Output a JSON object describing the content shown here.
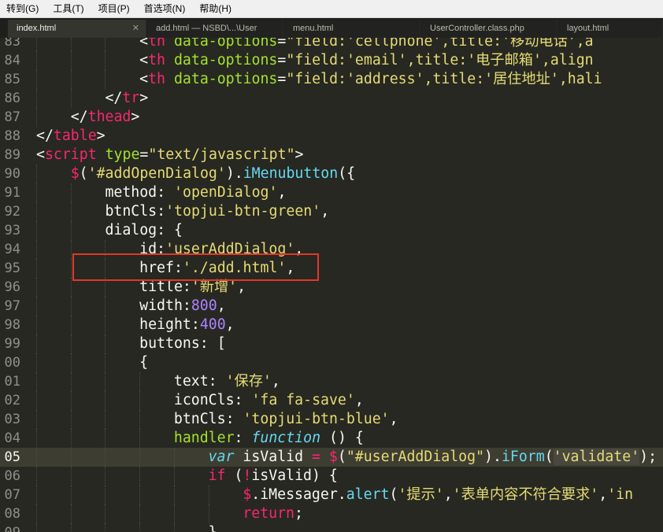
{
  "menubar": [
    {
      "label": "转到(G)"
    },
    {
      "label": "工具(T)"
    },
    {
      "label": "项目(P)"
    },
    {
      "label": "首选项(N)"
    },
    {
      "label": "帮助(H)"
    }
  ],
  "tabs": [
    {
      "label": "index.html",
      "active": true
    },
    {
      "label": "add.html — NSBD\\...\\User",
      "active": false
    },
    {
      "label": "menu.html",
      "active": false
    },
    {
      "label": "UserController.class.php",
      "active": false
    },
    {
      "label": "layout.html",
      "active": false
    }
  ],
  "current_line": "05",
  "lines": [
    {
      "n": "83",
      "indent": 3,
      "tokens": [
        {
          "t": "<",
          "c": "plain"
        },
        {
          "t": "th",
          "c": "tag"
        },
        {
          "t": " ",
          "c": "plain"
        },
        {
          "t": "data-options",
          "c": "attr"
        },
        {
          "t": "=",
          "c": "plain"
        },
        {
          "t": "\"field:'cellphone',title:'移动电话',a",
          "c": "str"
        }
      ]
    },
    {
      "n": "84",
      "indent": 3,
      "tokens": [
        {
          "t": "<",
          "c": "plain"
        },
        {
          "t": "th",
          "c": "tag"
        },
        {
          "t": " ",
          "c": "plain"
        },
        {
          "t": "data-options",
          "c": "attr"
        },
        {
          "t": "=",
          "c": "plain"
        },
        {
          "t": "\"field:'email',title:'电子邮箱',align",
          "c": "str"
        }
      ]
    },
    {
      "n": "85",
      "indent": 3,
      "tokens": [
        {
          "t": "<",
          "c": "plain"
        },
        {
          "t": "th",
          "c": "tag"
        },
        {
          "t": " ",
          "c": "plain"
        },
        {
          "t": "data-options",
          "c": "attr"
        },
        {
          "t": "=",
          "c": "plain"
        },
        {
          "t": "\"field:'address',title:'居住地址',hali",
          "c": "str"
        }
      ]
    },
    {
      "n": "86",
      "indent": 2,
      "tokens": [
        {
          "t": "</",
          "c": "plain"
        },
        {
          "t": "tr",
          "c": "tag"
        },
        {
          "t": ">",
          "c": "plain"
        }
      ]
    },
    {
      "n": "87",
      "indent": 1,
      "tokens": [
        {
          "t": "</",
          "c": "plain"
        },
        {
          "t": "thead",
          "c": "tag"
        },
        {
          "t": ">",
          "c": "plain"
        }
      ]
    },
    {
      "n": "88",
      "indent": 0,
      "tokens": [
        {
          "t": "</",
          "c": "plain"
        },
        {
          "t": "table",
          "c": "tag"
        },
        {
          "t": ">",
          "c": "plain"
        }
      ]
    },
    {
      "n": "89",
      "indent": 0,
      "tokens": [
        {
          "t": "<",
          "c": "plain"
        },
        {
          "t": "script",
          "c": "tag"
        },
        {
          "t": " ",
          "c": "plain"
        },
        {
          "t": "type",
          "c": "attr"
        },
        {
          "t": "=",
          "c": "plain"
        },
        {
          "t": "\"text/javascript\"",
          "c": "str"
        },
        {
          "t": ">",
          "c": "plain"
        }
      ]
    },
    {
      "n": "90",
      "indent": 1,
      "tokens": [
        {
          "t": "$",
          "c": "op"
        },
        {
          "t": "(",
          "c": "plain"
        },
        {
          "t": "'#addOpenDialog'",
          "c": "str"
        },
        {
          "t": ").",
          "c": "plain"
        },
        {
          "t": "iMenubutton",
          "c": "fn"
        },
        {
          "t": "({",
          "c": "plain"
        }
      ]
    },
    {
      "n": "91",
      "indent": 2,
      "tokens": [
        {
          "t": "method: ",
          "c": "plain"
        },
        {
          "t": "'openDialog'",
          "c": "str"
        },
        {
          "t": ",",
          "c": "plain"
        }
      ]
    },
    {
      "n": "92",
      "indent": 2,
      "tokens": [
        {
          "t": "btnCls:",
          "c": "plain"
        },
        {
          "t": "'topjui-btn-green'",
          "c": "str"
        },
        {
          "t": ",",
          "c": "plain"
        }
      ]
    },
    {
      "n": "93",
      "indent": 2,
      "tokens": [
        {
          "t": "dialog: {",
          "c": "plain"
        }
      ]
    },
    {
      "n": "94",
      "indent": 3,
      "tokens": [
        {
          "t": "id:",
          "c": "plain"
        },
        {
          "t": "'userAddDialog'",
          "c": "str"
        },
        {
          "t": ",",
          "c": "plain"
        }
      ]
    },
    {
      "n": "95",
      "indent": 3,
      "tokens": [
        {
          "t": "href:",
          "c": "plain"
        },
        {
          "t": "'./add.html'",
          "c": "str"
        },
        {
          "t": ",",
          "c": "plain"
        }
      ]
    },
    {
      "n": "96",
      "indent": 3,
      "tokens": [
        {
          "t": "title:",
          "c": "plain"
        },
        {
          "t": "'新增'",
          "c": "str"
        },
        {
          "t": ",",
          "c": "plain"
        }
      ]
    },
    {
      "n": "97",
      "indent": 3,
      "tokens": [
        {
          "t": "width:",
          "c": "plain"
        },
        {
          "t": "800",
          "c": "num"
        },
        {
          "t": ",",
          "c": "plain"
        }
      ]
    },
    {
      "n": "98",
      "indent": 3,
      "tokens": [
        {
          "t": "height:",
          "c": "plain"
        },
        {
          "t": "400",
          "c": "num"
        },
        {
          "t": ",",
          "c": "plain"
        }
      ]
    },
    {
      "n": "99",
      "indent": 3,
      "tokens": [
        {
          "t": "buttons: [",
          "c": "plain"
        }
      ]
    },
    {
      "n": "00",
      "indent": 3,
      "tokens": [
        {
          "t": "{",
          "c": "plain"
        }
      ]
    },
    {
      "n": "01",
      "indent": 4,
      "tokens": [
        {
          "t": "text: ",
          "c": "plain"
        },
        {
          "t": "'保存'",
          "c": "str"
        },
        {
          "t": ",",
          "c": "plain"
        }
      ]
    },
    {
      "n": "02",
      "indent": 4,
      "tokens": [
        {
          "t": "iconCls: ",
          "c": "plain"
        },
        {
          "t": "'fa fa-save'",
          "c": "str"
        },
        {
          "t": ",",
          "c": "plain"
        }
      ]
    },
    {
      "n": "03",
      "indent": 4,
      "tokens": [
        {
          "t": "btnCls: ",
          "c": "plain"
        },
        {
          "t": "'topjui-btn-blue'",
          "c": "str"
        },
        {
          "t": ",",
          "c": "plain"
        }
      ]
    },
    {
      "n": "04",
      "indent": 4,
      "tokens": [
        {
          "t": "handler",
          "c": "attr"
        },
        {
          "t": ": ",
          "c": "plain"
        },
        {
          "t": "function",
          "c": "kw"
        },
        {
          "t": " () {",
          "c": "plain"
        }
      ]
    },
    {
      "n": "05",
      "indent": 5,
      "tokens": [
        {
          "t": "var",
          "c": "kw"
        },
        {
          "t": " isValid ",
          "c": "plain"
        },
        {
          "t": "=",
          "c": "op"
        },
        {
          "t": " ",
          "c": "plain"
        },
        {
          "t": "$",
          "c": "op"
        },
        {
          "t": "(",
          "c": "plain"
        },
        {
          "t": "\"#userAddDialog\"",
          "c": "str"
        },
        {
          "t": ").",
          "c": "plain"
        },
        {
          "t": "iForm",
          "c": "fn"
        },
        {
          "t": "(",
          "c": "plain"
        },
        {
          "t": "'validate'",
          "c": "str"
        },
        {
          "t": ");",
          "c": "plain"
        }
      ]
    },
    {
      "n": "06",
      "indent": 5,
      "tokens": [
        {
          "t": "if",
          "c": "op"
        },
        {
          "t": " (",
          "c": "plain"
        },
        {
          "t": "!",
          "c": "op"
        },
        {
          "t": "isValid) {",
          "c": "plain"
        }
      ]
    },
    {
      "n": "07",
      "indent": 6,
      "tokens": [
        {
          "t": "$",
          "c": "op"
        },
        {
          "t": ".",
          "c": "plain"
        },
        {
          "t": "iMessager",
          "c": "plain"
        },
        {
          "t": ".",
          "c": "plain"
        },
        {
          "t": "alert",
          "c": "fn"
        },
        {
          "t": "(",
          "c": "plain"
        },
        {
          "t": "'提示'",
          "c": "str"
        },
        {
          "t": ",",
          "c": "plain"
        },
        {
          "t": "'表单内容不符合要求'",
          "c": "str"
        },
        {
          "t": ",",
          "c": "plain"
        },
        {
          "t": "'in",
          "c": "str"
        }
      ]
    },
    {
      "n": "08",
      "indent": 6,
      "tokens": [
        {
          "t": "return",
          "c": "op"
        },
        {
          "t": ";",
          "c": "plain"
        }
      ]
    },
    {
      "n": "09",
      "indent": 5,
      "tokens": [
        {
          "t": "}",
          "c": "plain"
        }
      ]
    }
  ]
}
